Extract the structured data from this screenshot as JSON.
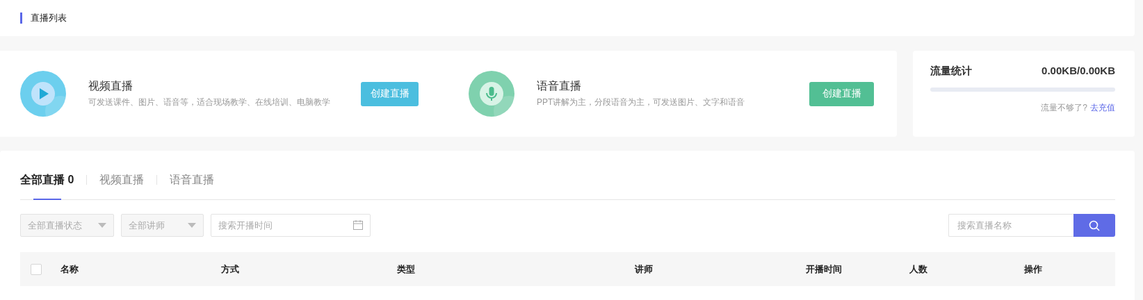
{
  "header": {
    "title": "直播列表"
  },
  "create_cards": [
    {
      "kind": "video",
      "title": "视频直播",
      "description": "可发送课件、图片、语音等，适合现场教学、在线培训、电脑教学",
      "button": "创建直播",
      "color": "#4bbedf"
    },
    {
      "kind": "voice",
      "title": "语音直播",
      "description": "PPT讲解为主，分段语音为主，可发送图片、文字和语音",
      "button": "创建直播",
      "color": "#52bf94"
    }
  ],
  "traffic": {
    "title": "流量统计",
    "value": "0.00KB/0.00KB",
    "level": 0,
    "hint": "流量不够了?",
    "link": "去充值"
  },
  "tabs": [
    {
      "label": "全部直播 0",
      "selected": true
    },
    {
      "label": "视频直播",
      "selected": false
    },
    {
      "label": "语音直播",
      "selected": false
    }
  ],
  "filters": [
    {
      "kind": "select",
      "value": "全部直播状态"
    },
    {
      "kind": "select",
      "value": "全部讲师"
    },
    {
      "kind": "date",
      "placeholder": "搜索开播时间"
    }
  ],
  "search": {
    "placeholder": "搜索直播名称"
  },
  "table": {
    "select_all": {
      "checked": false
    },
    "columns": [
      "名称",
      "方式",
      "类型",
      "讲师",
      "开播时间",
      "人数",
      "操作"
    ]
  }
}
